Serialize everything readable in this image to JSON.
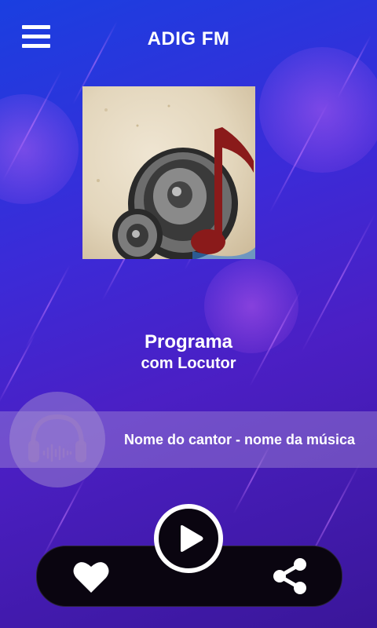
{
  "header": {
    "title": "ADIG FM"
  },
  "now_playing": {
    "program": "Programa",
    "host": "com Locutor",
    "song": "Nome do cantor - nome da música"
  },
  "icons": {
    "menu": "menu-icon",
    "headphones": "headphones-icon",
    "play": "play-icon",
    "heart": "heart-icon",
    "share": "share-icon"
  },
  "colors": {
    "accent": "#ffffff",
    "background_top": "#1a3fe0",
    "background_bottom": "#3a1699",
    "player_bar": "#0a0510"
  }
}
